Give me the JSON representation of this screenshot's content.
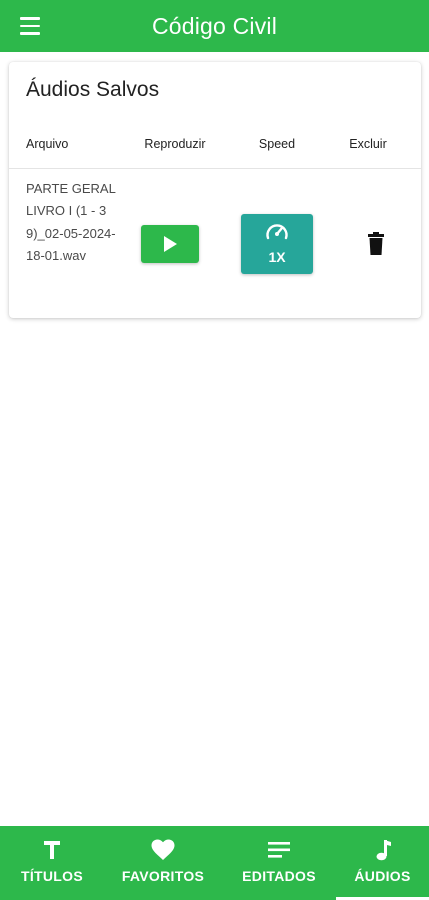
{
  "appbar": {
    "title": "Código Civil",
    "menu_icon": "hamburger-menu-icon"
  },
  "card": {
    "title": "Áudios Salvos",
    "columns": [
      "Arquivo",
      "Reproduzir",
      "Speed",
      "Excluir"
    ],
    "rows": [
      {
        "file": "PARTE GERAL LIVRO I (1 - 39)_02-05-2024-18-01.wav",
        "play_icon": "play-icon",
        "speed_icon": "speedometer-icon",
        "speed": "1X",
        "delete_icon": "trash-icon"
      }
    ]
  },
  "bottom_nav": {
    "items": [
      {
        "label": "TÍTULOS",
        "icon": "title-t-icon",
        "active": false
      },
      {
        "label": "FAVORITOS",
        "icon": "heart-icon",
        "active": false
      },
      {
        "label": "EDITADOS",
        "icon": "lines-icon",
        "active": false
      },
      {
        "label": "ÁUDIOS",
        "icon": "music-note-icon",
        "active": true
      }
    ]
  },
  "colors": {
    "primary": "#2db84b",
    "speed_button": "#26a69a",
    "text": "#222222"
  }
}
